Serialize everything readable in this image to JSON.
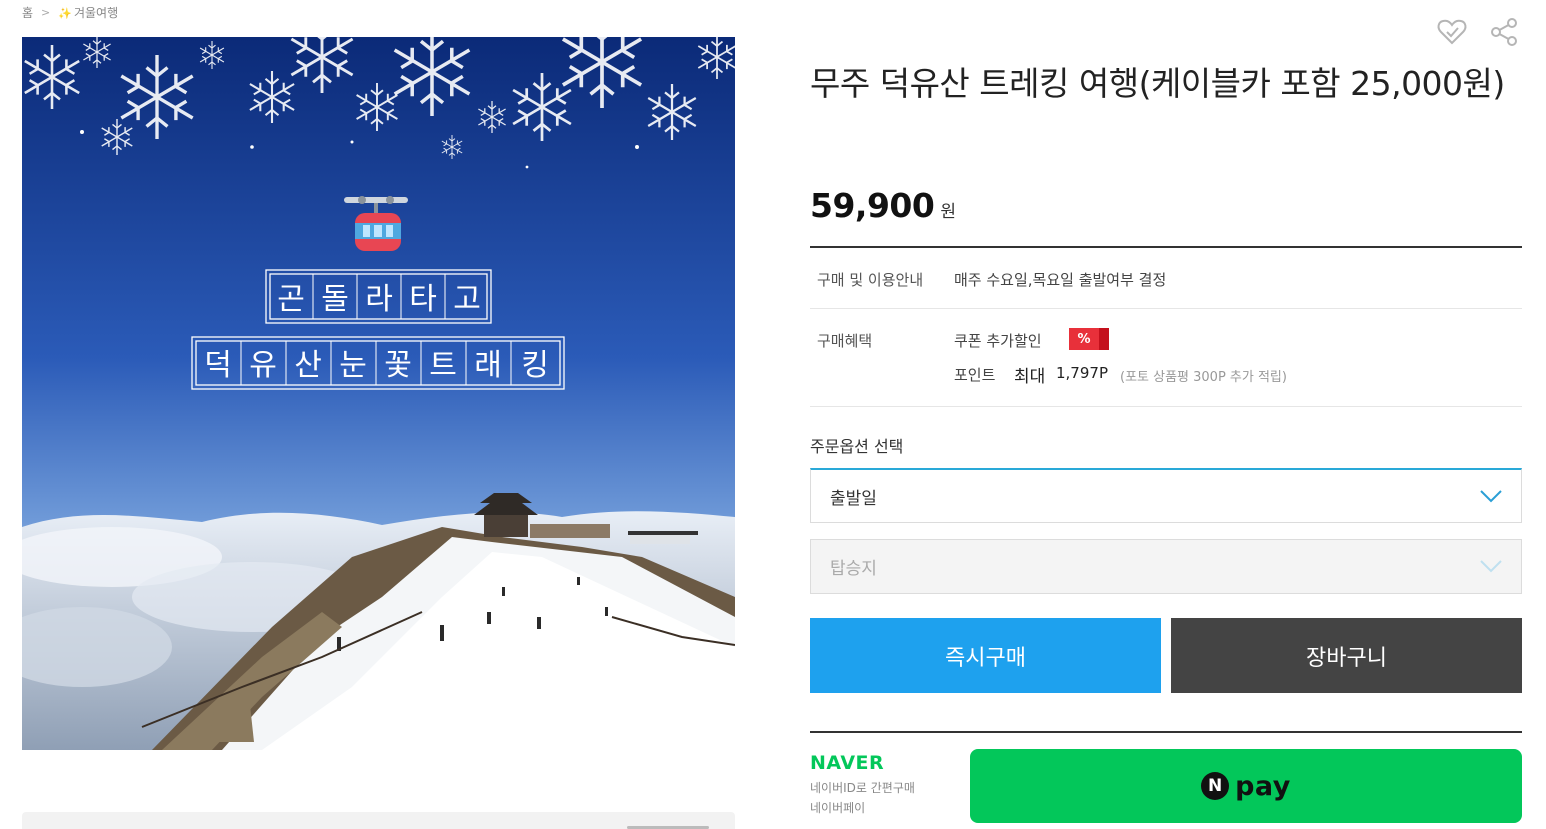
{
  "breadcrumb": {
    "home": "홈",
    "category": "겨울여행"
  },
  "product": {
    "title": "무주 덕유산 트레킹 여행(케이블카 포함 25,000원)",
    "price": "59,900",
    "price_unit": "원",
    "image_text": {
      "line1": [
        "곤",
        "돌",
        "라",
        "타",
        "고"
      ],
      "line2": [
        "덕",
        "유",
        "산",
        "눈",
        "꽃",
        "트",
        "래",
        "킹"
      ]
    }
  },
  "info": {
    "guide_label": "구매 및 이용안내",
    "guide_value": "매주 수요일,목요일 출발여부 결정",
    "benefit_label": "구매혜택",
    "coupon_label": "쿠폰 추가할인",
    "coupon_badge": "%",
    "points_label": "포인트",
    "points_max": "최대",
    "points_value": "1,797P",
    "points_note": "(포토 상품평 300P 추가 적립)"
  },
  "options": {
    "title": "주문옵션 선택",
    "departure_placeholder": "출발일",
    "boarding_placeholder": "탑승지"
  },
  "buttons": {
    "buy_now": "즉시구매",
    "cart": "장바구니"
  },
  "naver": {
    "logo": "NAVER",
    "sub1": "네이버ID로 간편구매",
    "sub2": "네이버페이",
    "pay_n": "N",
    "pay_label": "pay"
  },
  "icons": {
    "wishlist": "heart-check-icon",
    "share": "share-icon",
    "dropdown": "chevron-down-icon"
  },
  "colors": {
    "buy_button": "#1ea1ee",
    "cart_button": "#444444",
    "naver_green": "#03c75a",
    "select_focus": "#29a9d8",
    "coupon_red": "#e8303a"
  }
}
